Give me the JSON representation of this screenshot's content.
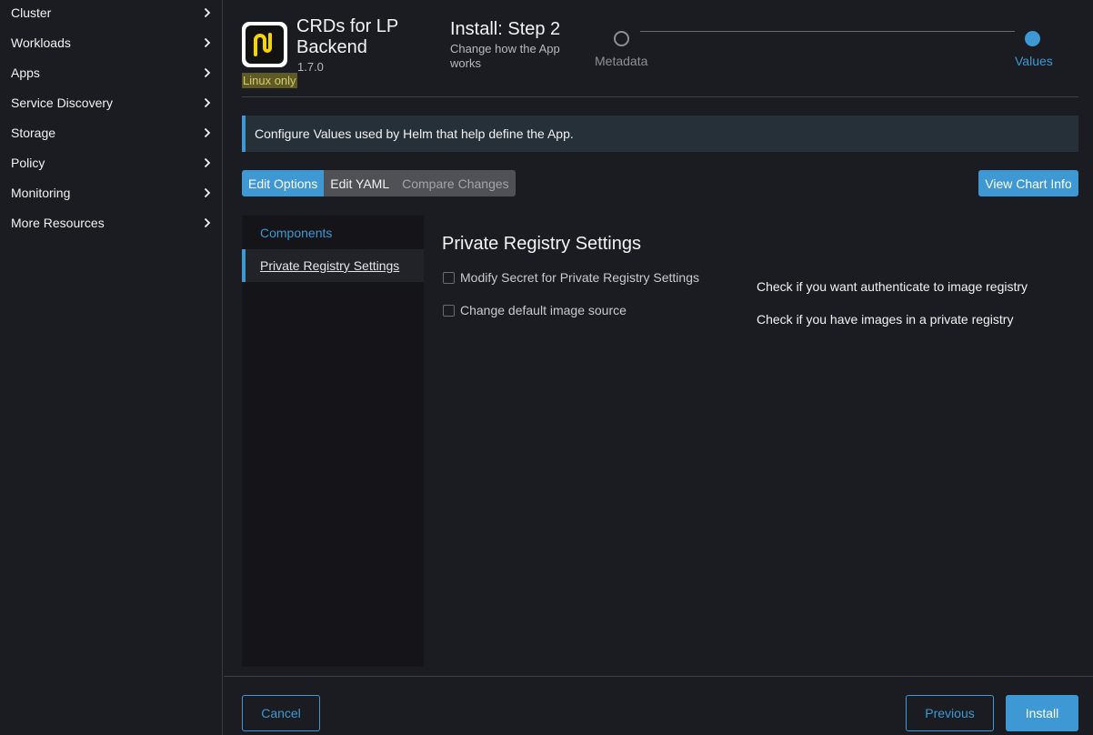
{
  "sidebar": {
    "items": [
      {
        "label": "Cluster"
      },
      {
        "label": "Workloads"
      },
      {
        "label": "Apps"
      },
      {
        "label": "Service Discovery"
      },
      {
        "label": "Storage"
      },
      {
        "label": "Policy"
      },
      {
        "label": "Monitoring"
      },
      {
        "label": "More Resources"
      }
    ],
    "chevron_icon": "chevron-right-icon"
  },
  "app": {
    "name": "CRDs for LP Backend",
    "version": "1.7.0",
    "os_badge": "Linux only",
    "logo_icon": "nu-logo-icon"
  },
  "wizard": {
    "title": "Install: Step 2",
    "subtitle": "Change how the App works",
    "steps": [
      {
        "label": "Metadata",
        "state": "done"
      },
      {
        "label": "Values",
        "state": "active"
      }
    ]
  },
  "banner": {
    "text": "Configure Values used by Helm that help define the App."
  },
  "tabs": [
    {
      "label": "Edit Options",
      "state": "active"
    },
    {
      "label": "Edit YAML",
      "state": "normal"
    },
    {
      "label": "Compare Changes",
      "state": "disabled"
    }
  ],
  "view_chart_info_label": "View Chart Info",
  "side_nav": {
    "items": [
      {
        "label": "Components"
      },
      {
        "label": "Private Registry Settings",
        "selected": true
      }
    ]
  },
  "section": {
    "title": "Private Registry Settings",
    "options": [
      {
        "label": "Modify Secret for Private Registry Settings",
        "checked": false,
        "help": "Check if you want authenticate to image registry"
      },
      {
        "label": "Change default image source",
        "checked": false,
        "help": "Check if you have images in a private registry"
      }
    ]
  },
  "footer": {
    "cancel_label": "Cancel",
    "previous_label": "Previous",
    "install_label": "Install"
  },
  "colors": {
    "accent": "#3d98d3",
    "background": "#1b1c21",
    "badge_bg": "#5e5a26",
    "badge_text": "#d7c96a"
  }
}
